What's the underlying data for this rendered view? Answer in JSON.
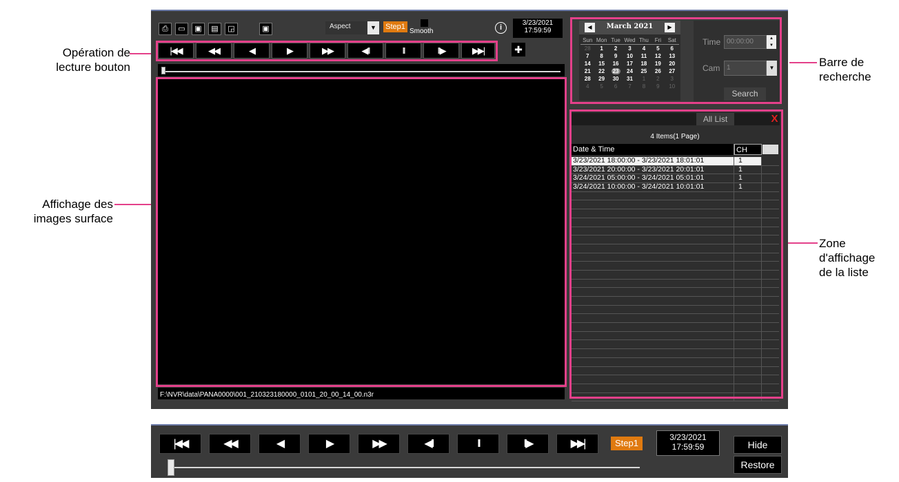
{
  "callouts": {
    "playback": [
      "Opération de",
      "lecture bouton"
    ],
    "image_area": [
      "Affichage des",
      "images surface"
    ],
    "search_bar": [
      "Barre de",
      "recherche"
    ],
    "list_area": [
      "Zone",
      "d'affichage",
      "de la liste"
    ]
  },
  "toolbar": {
    "aspect_label": "Aspect",
    "step_label": "Step1",
    "smooth_label": "Smooth",
    "info_icon": "info-icon"
  },
  "clock": {
    "date": "3/23/2021",
    "time": "17:59:59"
  },
  "playback_buttons": [
    "|◀◀",
    "◀◀",
    "◀",
    "▶",
    "▶▶",
    "◀II",
    "II",
    "II▶",
    "▶▶|"
  ],
  "calendar": {
    "month_title": "March 2021",
    "day_names": [
      "Sun",
      "Mon",
      "Tue",
      "Wed",
      "Thu",
      "Fri",
      "Sat"
    ],
    "weeks": [
      [
        "28",
        "1",
        "2",
        "3",
        "4",
        "5",
        "6"
      ],
      [
        "7",
        "8",
        "9",
        "10",
        "11",
        "12",
        "13"
      ],
      [
        "14",
        "15",
        "16",
        "17",
        "18",
        "19",
        "20"
      ],
      [
        "21",
        "22",
        "23",
        "24",
        "25",
        "26",
        "27"
      ],
      [
        "28",
        "29",
        "30",
        "31",
        "1",
        "2",
        "3"
      ],
      [
        "4",
        "5",
        "6",
        "7",
        "8",
        "9",
        "10"
      ]
    ]
  },
  "search": {
    "time_label": "Time",
    "time_value": "00:00:00",
    "cam_label": "Cam",
    "cam_value": "1",
    "search_button": "Search"
  },
  "list": {
    "header": "All List",
    "close": "X",
    "count": "4 Items(1 Page)",
    "columns": [
      "Date & Time",
      "CH"
    ],
    "rows": [
      [
        "3/23/2021 18:00:00 - 3/23/2021 18:01:01",
        "1"
      ],
      [
        "3/23/2021 20:00:00 - 3/23/2021 20:01:01",
        "1"
      ],
      [
        "3/24/2021 05:00:00 - 3/24/2021 05:01:01",
        "1"
      ],
      [
        "3/24/2021 10:00:00 - 3/24/2021 10:01:01",
        "1"
      ]
    ]
  },
  "status_path": "F:\\NVR\\data\\PANA0000\\001_210323180000_0101_20_00_14_00.n3r",
  "bottom_bar": {
    "step_label": "Step1",
    "date": "3/23/2021",
    "time": "17:59:59",
    "hide_label": "Hide",
    "restore_label": "Restore"
  },
  "colors": {
    "highlight": "#e4408a",
    "step_accent": "#e07a10",
    "close_red": "#e02020"
  }
}
